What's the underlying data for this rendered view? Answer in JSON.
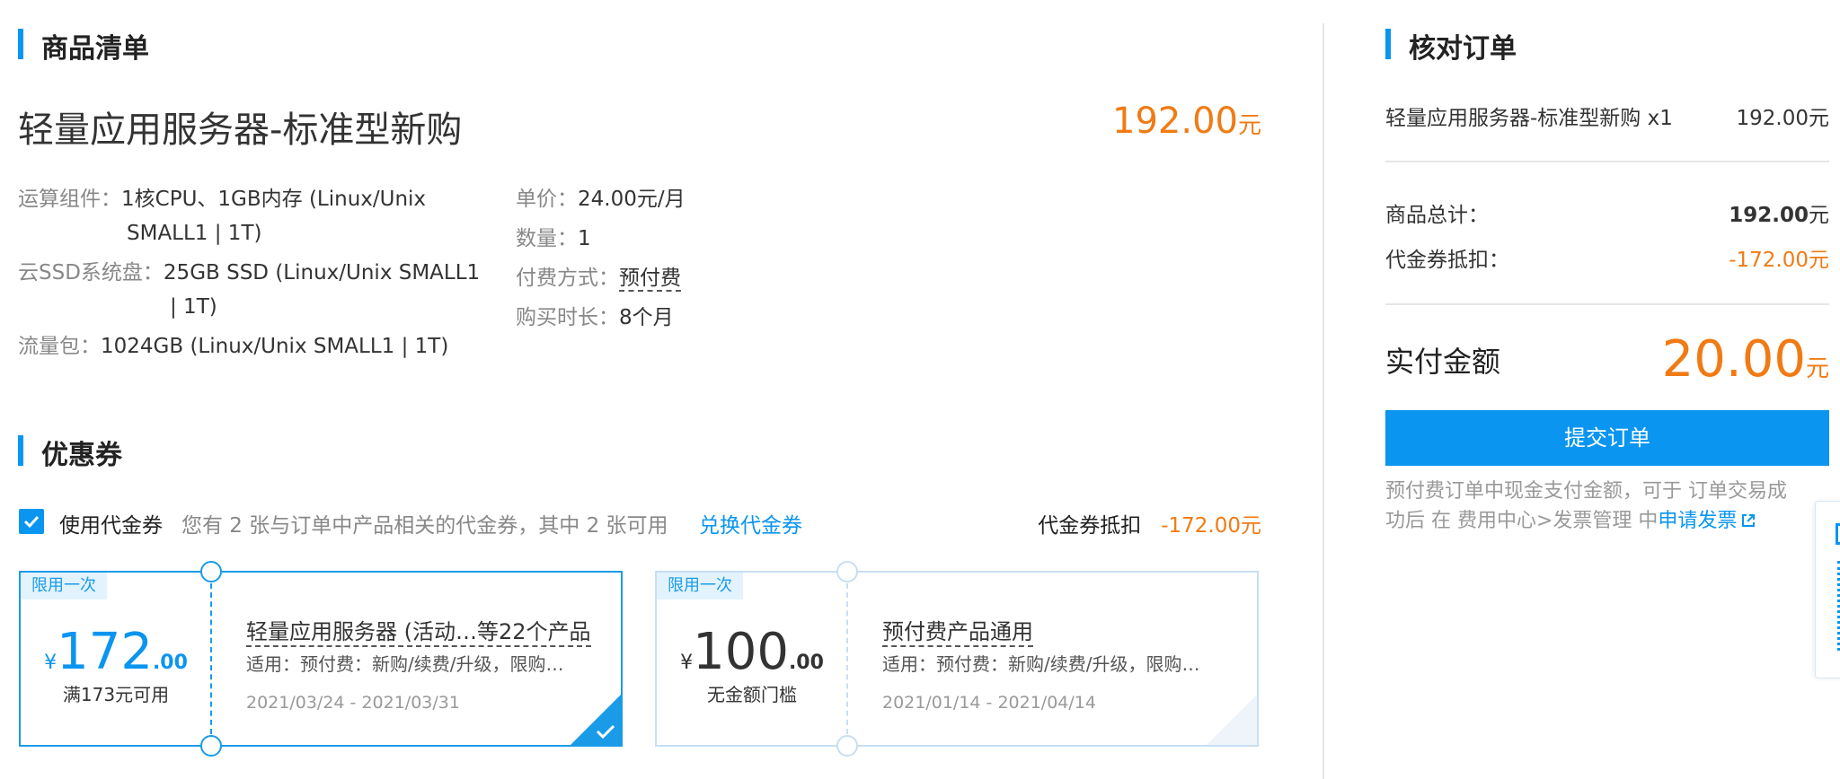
{
  "product_list": {
    "section_title": "商品清单",
    "product_name": "轻量应用服务器-标准型新购",
    "price_value": "192.00",
    "currency": "元",
    "specs_left": [
      {
        "label": "运算组件：",
        "value_line1": "1核CPU、1GB内存 (Linux/Unix",
        "value_line2": "SMALL1 | 1T)"
      },
      {
        "label": "云SSD系统盘：",
        "value_line1": "25GB SSD (Linux/Unix SMALL1",
        "value_line2": "| 1T)"
      },
      {
        "label": "流量包：",
        "value_line1": "1024GB (Linux/Unix SMALL1 | 1T)"
      }
    ],
    "specs_right": [
      {
        "label": "单价：",
        "value": "24.00元/月"
      },
      {
        "label": "数量：",
        "value": "1"
      },
      {
        "label": "付费方式：",
        "value": "预付费"
      },
      {
        "label": "购买时长：",
        "value": "8个月"
      }
    ]
  },
  "coupons": {
    "section_title": "优惠券",
    "use_label": "使用代金券",
    "info": "您有 2 张与订单中产品相关的代金券，其中 2 张可用",
    "exchange_link": "兑换代金券",
    "deduct_label": "代金券抵扣",
    "deduct_value": "-172.00元",
    "items": [
      {
        "tag": "限用一次",
        "symbol": "¥",
        "amount_int": "172",
        "amount_dec": ".00",
        "condition": "满173元可用",
        "name": "轻量应用服务器 (活动…等22个产品",
        "desc": "适用：预付费：新购/续费/升级，限购…",
        "date": "2021/03/24 - 2021/03/31",
        "selected": true
      },
      {
        "tag": "限用一次",
        "symbol": "¥",
        "amount_int": "100",
        "amount_dec": ".00",
        "condition": "无金额门槛",
        "name": "预付费产品通用",
        "desc": "适用：预付费：新购/续费/升级，限购…",
        "date": "2021/01/14 - 2021/04/14",
        "selected": false
      }
    ]
  },
  "order": {
    "section_title": "核对订单",
    "line_name": "轻量应用服务器-标准型新购 x1",
    "line_price": "192.00元",
    "total_label": "商品总计：",
    "total_value": "192.00",
    "total_unit": "元",
    "coupon_label": "代金券抵扣：",
    "coupon_value": "-172.00元",
    "pay_label": "实付金额",
    "pay_value": "20.00",
    "pay_unit": "元",
    "submit_label": "提交订单",
    "note_line1": "预付费订单中现金支付金额，可于 订单交易成",
    "note_line2_prefix": "功后 在 费用中心>发票管理 中",
    "invoice_link": "申请发票"
  },
  "colors": {
    "accent": "#0a95f0",
    "price": "#f07b14"
  }
}
